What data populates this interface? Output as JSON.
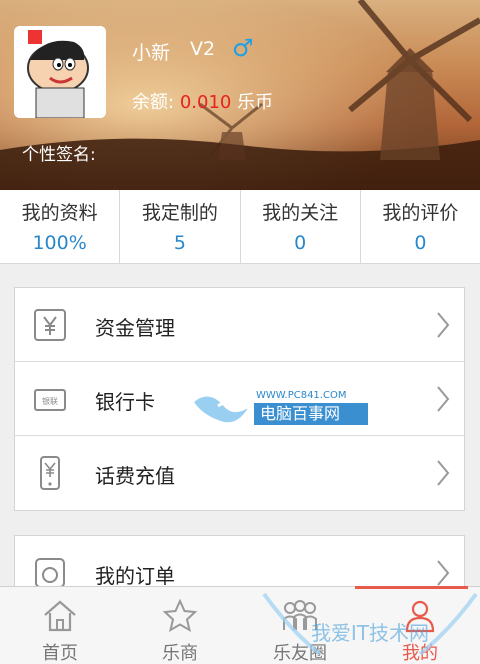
{
  "profile": {
    "username": "小新",
    "level": "V2",
    "gender_icon": "male-icon",
    "balance_label": "余额:",
    "balance_value": "0.010",
    "balance_unit": "乐币",
    "signature_label": "个性签名:"
  },
  "stats": [
    {
      "label": "我的资料",
      "value": "100%"
    },
    {
      "label": "我定制的",
      "value": "5"
    },
    {
      "label": "我的关注",
      "value": "0"
    },
    {
      "label": "我的评价",
      "value": "0"
    }
  ],
  "menu": [
    {
      "label": "资金管理",
      "icon": "yen-icon"
    },
    {
      "label": "银行卡",
      "icon": "bank-card-icon"
    },
    {
      "label": "话费充值",
      "icon": "phone-recharge-icon"
    },
    {
      "label": "我的订单",
      "icon": "order-icon"
    }
  ],
  "bank_card_icon_text": "银联",
  "watermarks": {
    "url": "WWW.PC841.COM",
    "name": "电脑百事网",
    "bottom_name": "我爱IT技术网"
  },
  "bottom_nav": [
    {
      "label": "首页",
      "icon": "home-icon"
    },
    {
      "label": "乐商",
      "icon": "star-icon"
    },
    {
      "label": "乐友圈",
      "icon": "friends-icon"
    },
    {
      "label": "我的",
      "icon": "user-icon",
      "active": true
    }
  ],
  "colors": {
    "accent_blue": "#2a88c9",
    "balance_red": "#e8221c",
    "active_red": "#e85a4a"
  }
}
